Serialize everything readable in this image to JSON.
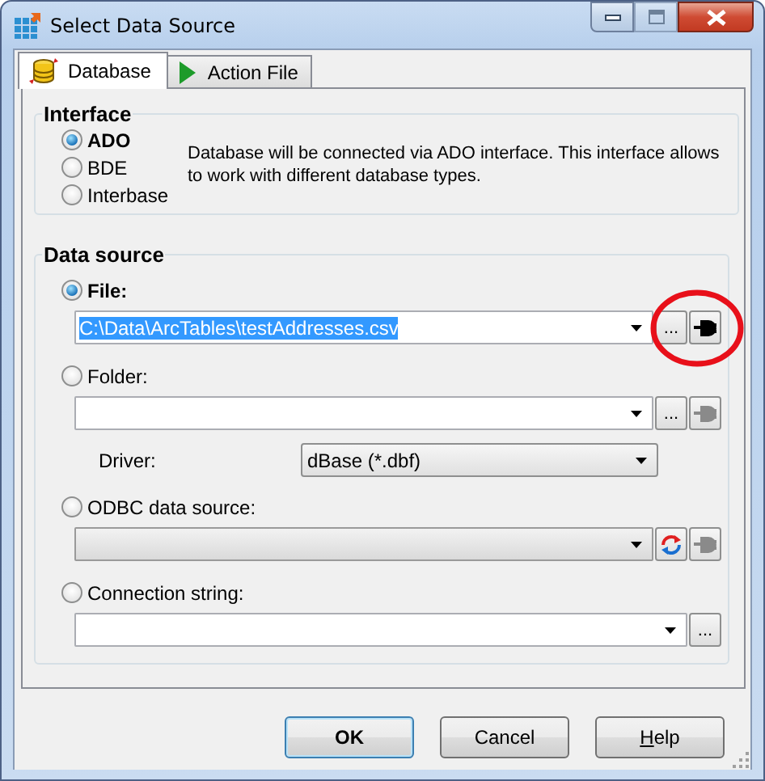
{
  "window": {
    "title": "Select Data Source",
    "maximize_disabled": true
  },
  "tabs": [
    {
      "label": "Database",
      "selected": true,
      "kind": "database"
    },
    {
      "label": "Action File",
      "selected": false,
      "kind": "action"
    }
  ],
  "interface": {
    "title": "Interface",
    "options": [
      {
        "label": "ADO",
        "selected": true
      },
      {
        "label": "BDE",
        "selected": false
      },
      {
        "label": "Interbase",
        "selected": false
      }
    ],
    "description": "Database will be connected via ADO interface. This interface allows to work with different database types."
  },
  "data_source": {
    "title": "Data source",
    "sources": [
      {
        "kind": "file",
        "label": "File:",
        "selected": true,
        "value": "C:\\Data\\ArcTables\\testAddresses.csv",
        "value_highlighted": true,
        "browse": "...",
        "connect_enabled": true,
        "circled": true
      },
      {
        "kind": "folder",
        "label": "Folder:",
        "selected": false,
        "browse": "...",
        "connect_enabled": false,
        "driver": {
          "label": "Driver:",
          "value": "dBase (*.dbf)"
        }
      },
      {
        "kind": "odbc",
        "label": "ODBC data source:",
        "selected": false,
        "disabled": true,
        "connect_enabled": false
      },
      {
        "kind": "connection",
        "label": "Connection string:",
        "selected": false,
        "browse": "..."
      }
    ]
  },
  "buttons": [
    {
      "label": "OK",
      "default": true,
      "mnemonic": false
    },
    {
      "label": "Cancel",
      "default": false,
      "mnemonic": false
    },
    {
      "label": "Help",
      "default": false,
      "mnemonic": true
    }
  ]
}
